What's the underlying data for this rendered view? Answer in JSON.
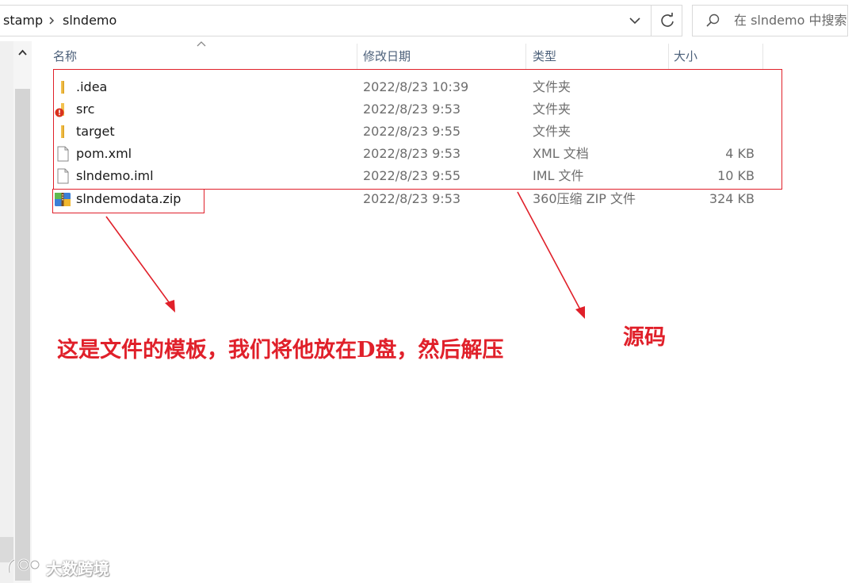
{
  "address_bar": {
    "breadcrumbs": [
      "stamp",
      "slndemo"
    ],
    "separator_icon": "chevron-right-icon",
    "dropdown_icon": "chevron-down-icon",
    "refresh_icon": "refresh-icon"
  },
  "search": {
    "placeholder": "在 slndemo 中搜索",
    "icon": "search-icon"
  },
  "columns": {
    "name": "名称",
    "date": "修改日期",
    "type": "类型",
    "size": "大小"
  },
  "files": [
    {
      "name": ".idea",
      "date": "2022/8/23 10:39",
      "type": "文件夹",
      "size": "",
      "icon": "folder-icon"
    },
    {
      "name": "src",
      "date": "2022/8/23 9:53",
      "type": "文件夹",
      "size": "",
      "icon": "folder-warning-icon"
    },
    {
      "name": "target",
      "date": "2022/8/23 9:55",
      "type": "文件夹",
      "size": "",
      "icon": "folder-icon"
    },
    {
      "name": "pom.xml",
      "date": "2022/8/23 9:53",
      "type": "XML 文档",
      "size": "4 KB",
      "icon": "file-icon"
    },
    {
      "name": "slndemo.iml",
      "date": "2022/8/23 9:55",
      "type": "IML 文件",
      "size": "10 KB",
      "icon": "file-icon"
    },
    {
      "name": "slndemodata.zip",
      "date": "2022/8/23 9:53",
      "type": "360压缩 ZIP 文件",
      "size": "324 KB",
      "icon": "zip-archive-icon"
    }
  ],
  "annotations": {
    "template_note": "这是文件的模板，我们将他放在D盘，然后解压",
    "source_note": "源码",
    "color": "#e0202a"
  },
  "watermark": {
    "text": "大数跨境"
  },
  "colors": {
    "header_text": "#4c607a",
    "folder": "#f2c14e",
    "annotation": "#e0202a"
  }
}
